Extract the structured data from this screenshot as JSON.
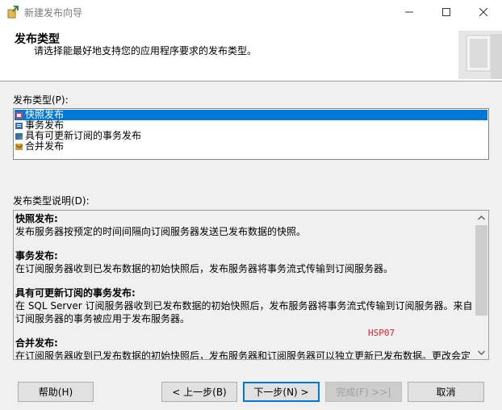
{
  "window": {
    "title": "新建发布向导",
    "controls": [
      "minimize-icon",
      "maximize-icon",
      "close-icon"
    ]
  },
  "header": {
    "title": "发布类型",
    "subtitle": "请选择能最好地支持您的应用程序要求的发布类型。"
  },
  "publication_type": {
    "label": "发布类型(P):",
    "items": [
      {
        "label": "快照发布",
        "icon": "snapshot-publication-icon",
        "selected": true
      },
      {
        "label": "事务发布",
        "icon": "transactional-publication-icon",
        "selected": false
      },
      {
        "label": "具有可更新订阅的事务发布",
        "icon": "updatable-publication-icon",
        "selected": false
      },
      {
        "label": "合并发布",
        "icon": "merge-publication-icon",
        "selected": false
      }
    ]
  },
  "description": {
    "label": "发布类型说明(D):",
    "sections": [
      {
        "title": "快照发布:",
        "body": "发布服务器按预定的时间间隔向订阅服务器发送已发布数据的快照。"
      },
      {
        "title": "事务发布:",
        "body": "在订阅服务器收到已发布数据的初始快照后，发布服务器将事务流式传输到订阅服务器。"
      },
      {
        "title": "具有可更新订阅的事务发布:",
        "body": "在 SQL Server 订阅服务器收到已发布数据的初始快照后，发布服务器将事务流式传输到订阅服务器。来自订阅服务器的事务被应用于发布服务器。"
      },
      {
        "title": "合并发布:",
        "body": "在订阅服务器收到已发布数据的初始快照后，发布服务器和订阅服务器可以独立更新已发布数据。更改会定"
      }
    ],
    "watermark": "HSP07"
  },
  "buttons": {
    "help": "帮助(H)",
    "back": "< 上一步(B)",
    "next": "下一步(N) >",
    "finish": "完成(F) >>|",
    "cancel": "取消"
  },
  "colors": {
    "selection": "#0078d7",
    "window_bg": "#f0f0f0",
    "watermark": "#e0202a"
  }
}
